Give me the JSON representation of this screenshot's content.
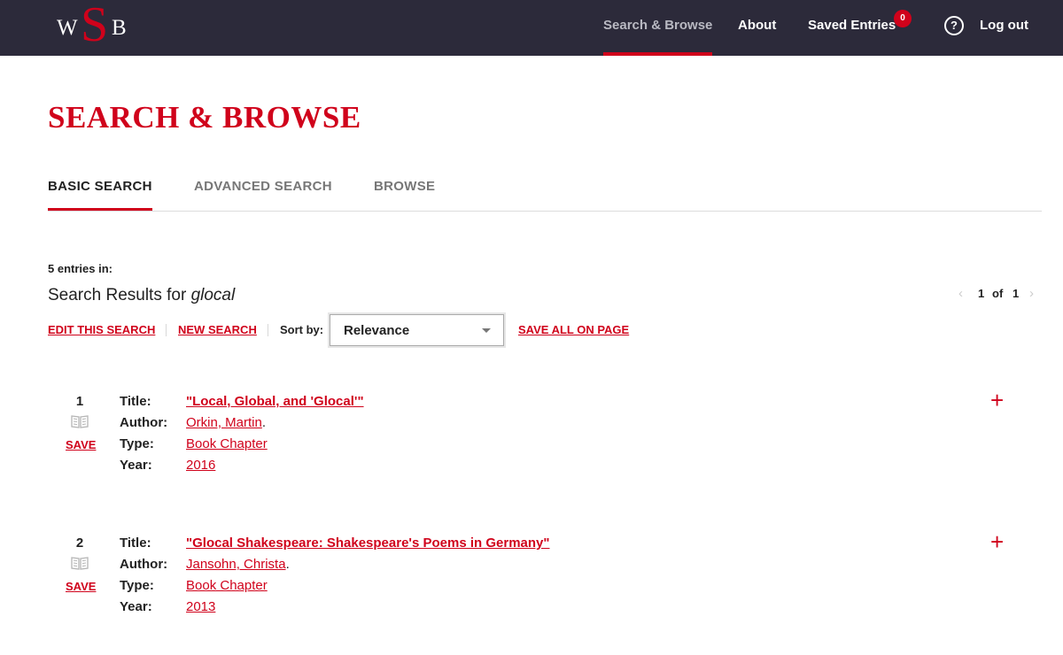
{
  "header": {
    "logo_left": "W",
    "logo_mid": "S",
    "logo_right": "B",
    "nav_search": "Search & Browse",
    "nav_about": "About",
    "nav_saved": "Saved Entries",
    "saved_count": "0",
    "help_glyph": "?",
    "nav_logout": "Log out"
  },
  "page_title": "SEARCH & BROWSE",
  "tabs": [
    {
      "label": "BASIC SEARCH",
      "active": true
    },
    {
      "label": "ADVANCED SEARCH",
      "active": false
    },
    {
      "label": "BROWSE",
      "active": false
    }
  ],
  "results": {
    "entries_label": "5 entries in:",
    "title_prefix": "Search Results for ",
    "query": "glocal",
    "edit_search": "EDIT THIS SEARCH",
    "new_search": "NEW SEARCH",
    "sort_label": "Sort by:",
    "sort_value": "Relevance",
    "save_all": "SAVE ALL ON PAGE",
    "pager": {
      "current": "1",
      "of": "of",
      "total": "1"
    }
  },
  "field_labels": {
    "title": "Title:",
    "author": "Author:",
    "type": "Type:",
    "year": "Year:"
  },
  "entries": [
    {
      "num": "1",
      "save": "SAVE",
      "title": "\"Local, Global, and 'Glocal'\"",
      "author": "Orkin, Martin",
      "type": "Book Chapter",
      "year": "2016"
    },
    {
      "num": "2",
      "save": "SAVE",
      "title": "\"Glocal Shakespeare: Shakespeare's Poems in Germany\"",
      "author": "Jansohn, Christa",
      "type": "Book Chapter",
      "year": "2013"
    }
  ],
  "icons": {
    "book": "book-icon",
    "plus": "plus-icon",
    "help": "help-circle-icon",
    "caret": "caret-down-icon"
  },
  "colors": {
    "accent": "#d0021b",
    "topbar": "#2c2a3a"
  }
}
